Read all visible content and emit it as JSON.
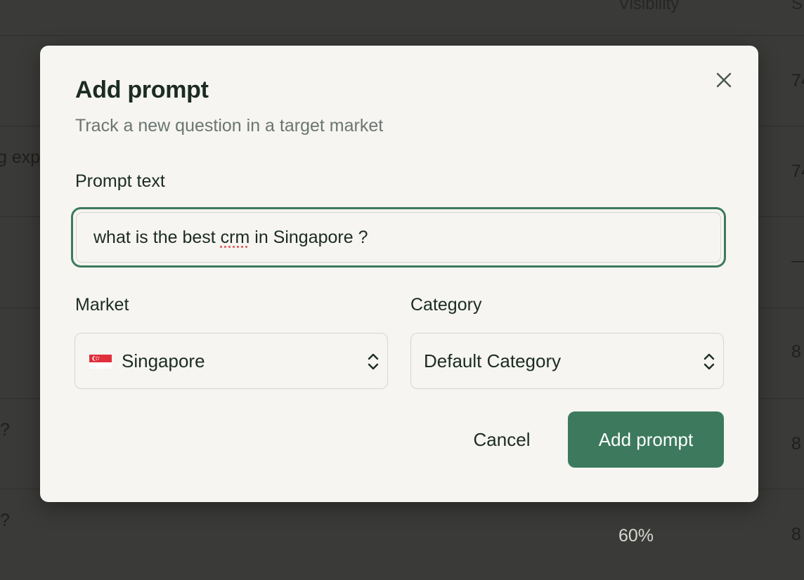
{
  "background": {
    "header": {
      "visibility": "Visibility",
      "col2": "S"
    },
    "rows": [
      {
        "col3": "74"
      },
      {
        "col1": "g exp",
        "col3": "74"
      },
      {
        "col3": "—"
      },
      {
        "col3": "8"
      },
      {
        "col1": "?",
        "col3": "8"
      },
      {
        "col1": "?",
        "col2": "60%",
        "col3": "8"
      }
    ]
  },
  "modal": {
    "title": "Add prompt",
    "subtitle": "Track a new question in a target market",
    "close_icon": "close-icon",
    "prompt": {
      "label": "Prompt text",
      "value_before": "what is the best ",
      "value_misspelled": "crm",
      "value_after": " in Singapore ?"
    },
    "market": {
      "label": "Market",
      "flag_icon": "singapore-flag-icon",
      "selected": "Singapore"
    },
    "category": {
      "label": "Category",
      "selected": "Default Category"
    },
    "actions": {
      "cancel": "Cancel",
      "submit": "Add prompt"
    },
    "colors": {
      "accent": "#3d7a5d",
      "overlay": "#3a3a39",
      "modal_bg": "#f6f5f1"
    }
  }
}
